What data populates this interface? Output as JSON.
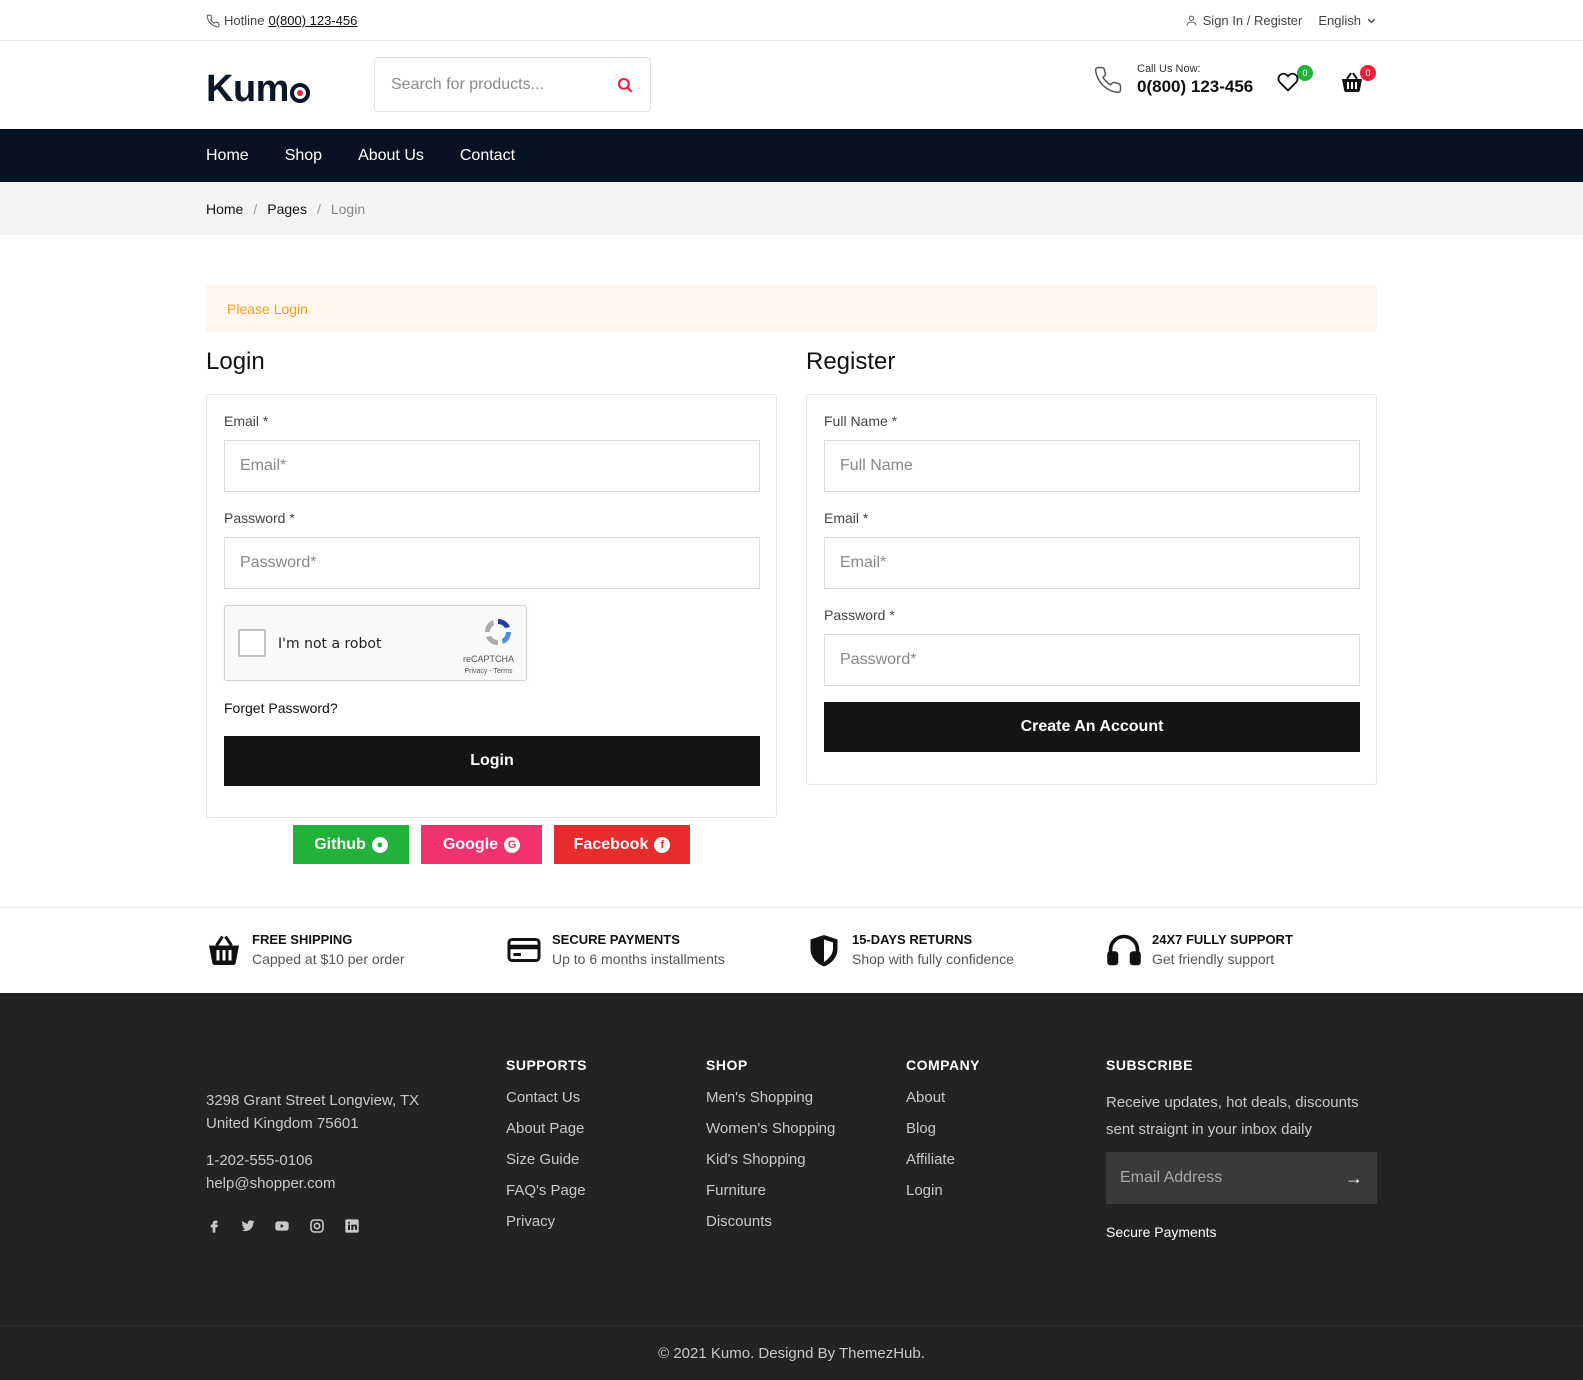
{
  "topbar": {
    "hotline_label": "Hotline",
    "hotline_number": "0(800) 123-456",
    "signin": "Sign In / Register",
    "language": "English"
  },
  "header": {
    "logo": "Kum",
    "search_placeholder": "Search for products...",
    "call_label": "Call Us Now:",
    "call_number": "0(800) 123-456",
    "wishlist_count": "0",
    "cart_count": "0"
  },
  "nav": {
    "items": [
      "Home",
      "Shop",
      "About Us",
      "Contact"
    ]
  },
  "breadcrumb": {
    "home": "Home",
    "pages": "Pages",
    "current": "Login"
  },
  "alert": "Please Login",
  "login": {
    "title": "Login",
    "email_label": "Email *",
    "email_placeholder": "Email*",
    "password_label": "Password *",
    "password_placeholder": "Password*",
    "captcha_text": "I'm not a robot",
    "captcha_brand": "reCAPTCHA",
    "captcha_links": "Privacy - Terms",
    "forgot": "Forget Password?",
    "button": "Login"
  },
  "register": {
    "title": "Register",
    "name_label": "Full Name *",
    "name_placeholder": "Full Name",
    "email_label": "Email *",
    "email_placeholder": "Email*",
    "password_label": "Password *",
    "password_placeholder": "Password*",
    "button": "Create An Account"
  },
  "social": {
    "github": "Github",
    "google": "Google",
    "facebook": "Facebook"
  },
  "features": [
    {
      "title": "FREE SHIPPING",
      "sub": "Capped at $10 per order"
    },
    {
      "title": "SECURE PAYMENTS",
      "sub": "Up to 6 months installments"
    },
    {
      "title": "15-DAYS RETURNS",
      "sub": "Shop with fully confidence"
    },
    {
      "title": "24X7 FULLY SUPPORT",
      "sub": "Get friendly support"
    }
  ],
  "footer": {
    "address1": "3298 Grant Street Longview, TX",
    "address2": "United Kingdom 75601",
    "phone": "1-202-555-0106",
    "email": "help@shopper.com",
    "supports": {
      "title": "SUPPORTS",
      "links": [
        "Contact Us",
        "About Page",
        "Size Guide",
        "FAQ's Page",
        "Privacy"
      ]
    },
    "shop": {
      "title": "SHOP",
      "links": [
        "Men's Shopping",
        "Women's Shopping",
        "Kid's Shopping",
        "Furniture",
        "Discounts"
      ]
    },
    "company": {
      "title": "COMPANY",
      "links": [
        "About",
        "Blog",
        "Affiliate",
        "Login"
      ]
    },
    "subscribe": {
      "title": "SUBSCRIBE",
      "text": "Receive updates, hot deals, discounts sent straignt in your inbox daily",
      "placeholder": "Email Address",
      "secure": "Secure Payments"
    },
    "copyright": "© 2021 Kumo. Designd By ThemezHub."
  },
  "colors": {
    "nav_bg": "#071324",
    "accent": "#e5233f",
    "github": "#22b13a",
    "google": "#f0336f",
    "facebook": "#e62c2c",
    "footer_bg": "#232323"
  }
}
